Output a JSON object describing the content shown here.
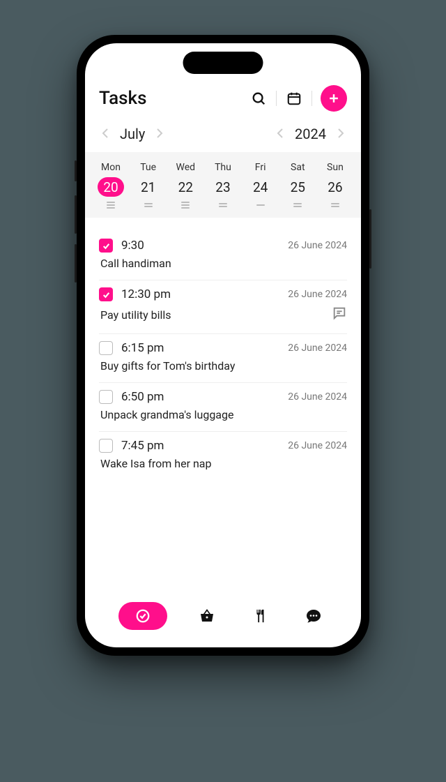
{
  "header": {
    "title": "Tasks"
  },
  "picker": {
    "month": "July",
    "year": "2024"
  },
  "week": [
    {
      "name": "Mon",
      "num": "20",
      "selected": true,
      "lines": 3
    },
    {
      "name": "Tue",
      "num": "21",
      "selected": false,
      "lines": 2
    },
    {
      "name": "Wed",
      "num": "22",
      "selected": false,
      "lines": 3
    },
    {
      "name": "Thu",
      "num": "23",
      "selected": false,
      "lines": 2
    },
    {
      "name": "Fri",
      "num": "24",
      "selected": false,
      "lines": 1
    },
    {
      "name": "Sat",
      "num": "25",
      "selected": false,
      "lines": 2
    },
    {
      "name": "Sun",
      "num": "26",
      "selected": false,
      "lines": 2
    }
  ],
  "tasks": [
    {
      "done": true,
      "time": "9:30",
      "date": "26 June 2024",
      "title": "Call handiman",
      "has_chat": false
    },
    {
      "done": true,
      "time": "12:30 pm",
      "date": "26 June 2024",
      "title": "Pay utility bills",
      "has_chat": true
    },
    {
      "done": false,
      "time": "6:15 pm",
      "date": "26 June 2024",
      "title": "Buy gifts for Tom's birthday",
      "has_chat": false
    },
    {
      "done": false,
      "time": "6:50 pm",
      "date": "26 June 2024",
      "title": "Unpack grandma's luggage",
      "has_chat": false
    },
    {
      "done": false,
      "time": "7:45 pm",
      "date": "26 June 2024",
      "title": "Wake Isa from her nap",
      "has_chat": false
    }
  ]
}
